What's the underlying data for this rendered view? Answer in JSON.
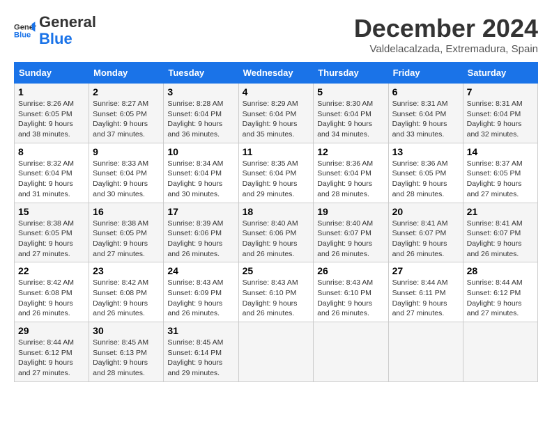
{
  "header": {
    "logo_line1": "General",
    "logo_line2": "Blue",
    "month": "December 2024",
    "location": "Valdelacalzada, Extremadura, Spain"
  },
  "weekdays": [
    "Sunday",
    "Monday",
    "Tuesday",
    "Wednesday",
    "Thursday",
    "Friday",
    "Saturday"
  ],
  "weeks": [
    [
      {
        "day": "1",
        "sunrise": "Sunrise: 8:26 AM",
        "sunset": "Sunset: 6:05 PM",
        "daylight": "Daylight: 9 hours and 38 minutes."
      },
      {
        "day": "2",
        "sunrise": "Sunrise: 8:27 AM",
        "sunset": "Sunset: 6:05 PM",
        "daylight": "Daylight: 9 hours and 37 minutes."
      },
      {
        "day": "3",
        "sunrise": "Sunrise: 8:28 AM",
        "sunset": "Sunset: 6:04 PM",
        "daylight": "Daylight: 9 hours and 36 minutes."
      },
      {
        "day": "4",
        "sunrise": "Sunrise: 8:29 AM",
        "sunset": "Sunset: 6:04 PM",
        "daylight": "Daylight: 9 hours and 35 minutes."
      },
      {
        "day": "5",
        "sunrise": "Sunrise: 8:30 AM",
        "sunset": "Sunset: 6:04 PM",
        "daylight": "Daylight: 9 hours and 34 minutes."
      },
      {
        "day": "6",
        "sunrise": "Sunrise: 8:31 AM",
        "sunset": "Sunset: 6:04 PM",
        "daylight": "Daylight: 9 hours and 33 minutes."
      },
      {
        "day": "7",
        "sunrise": "Sunrise: 8:31 AM",
        "sunset": "Sunset: 6:04 PM",
        "daylight": "Daylight: 9 hours and 32 minutes."
      }
    ],
    [
      {
        "day": "8",
        "sunrise": "Sunrise: 8:32 AM",
        "sunset": "Sunset: 6:04 PM",
        "daylight": "Daylight: 9 hours and 31 minutes."
      },
      {
        "day": "9",
        "sunrise": "Sunrise: 8:33 AM",
        "sunset": "Sunset: 6:04 PM",
        "daylight": "Daylight: 9 hours and 30 minutes."
      },
      {
        "day": "10",
        "sunrise": "Sunrise: 8:34 AM",
        "sunset": "Sunset: 6:04 PM",
        "daylight": "Daylight: 9 hours and 30 minutes."
      },
      {
        "day": "11",
        "sunrise": "Sunrise: 8:35 AM",
        "sunset": "Sunset: 6:04 PM",
        "daylight": "Daylight: 9 hours and 29 minutes."
      },
      {
        "day": "12",
        "sunrise": "Sunrise: 8:36 AM",
        "sunset": "Sunset: 6:04 PM",
        "daylight": "Daylight: 9 hours and 28 minutes."
      },
      {
        "day": "13",
        "sunrise": "Sunrise: 8:36 AM",
        "sunset": "Sunset: 6:05 PM",
        "daylight": "Daylight: 9 hours and 28 minutes."
      },
      {
        "day": "14",
        "sunrise": "Sunrise: 8:37 AM",
        "sunset": "Sunset: 6:05 PM",
        "daylight": "Daylight: 9 hours and 27 minutes."
      }
    ],
    [
      {
        "day": "15",
        "sunrise": "Sunrise: 8:38 AM",
        "sunset": "Sunset: 6:05 PM",
        "daylight": "Daylight: 9 hours and 27 minutes."
      },
      {
        "day": "16",
        "sunrise": "Sunrise: 8:38 AM",
        "sunset": "Sunset: 6:05 PM",
        "daylight": "Daylight: 9 hours and 27 minutes."
      },
      {
        "day": "17",
        "sunrise": "Sunrise: 8:39 AM",
        "sunset": "Sunset: 6:06 PM",
        "daylight": "Daylight: 9 hours and 26 minutes."
      },
      {
        "day": "18",
        "sunrise": "Sunrise: 8:40 AM",
        "sunset": "Sunset: 6:06 PM",
        "daylight": "Daylight: 9 hours and 26 minutes."
      },
      {
        "day": "19",
        "sunrise": "Sunrise: 8:40 AM",
        "sunset": "Sunset: 6:07 PM",
        "daylight": "Daylight: 9 hours and 26 minutes."
      },
      {
        "day": "20",
        "sunrise": "Sunrise: 8:41 AM",
        "sunset": "Sunset: 6:07 PM",
        "daylight": "Daylight: 9 hours and 26 minutes."
      },
      {
        "day": "21",
        "sunrise": "Sunrise: 8:41 AM",
        "sunset": "Sunset: 6:07 PM",
        "daylight": "Daylight: 9 hours and 26 minutes."
      }
    ],
    [
      {
        "day": "22",
        "sunrise": "Sunrise: 8:42 AM",
        "sunset": "Sunset: 6:08 PM",
        "daylight": "Daylight: 9 hours and 26 minutes."
      },
      {
        "day": "23",
        "sunrise": "Sunrise: 8:42 AM",
        "sunset": "Sunset: 6:08 PM",
        "daylight": "Daylight: 9 hours and 26 minutes."
      },
      {
        "day": "24",
        "sunrise": "Sunrise: 8:43 AM",
        "sunset": "Sunset: 6:09 PM",
        "daylight": "Daylight: 9 hours and 26 minutes."
      },
      {
        "day": "25",
        "sunrise": "Sunrise: 8:43 AM",
        "sunset": "Sunset: 6:10 PM",
        "daylight": "Daylight: 9 hours and 26 minutes."
      },
      {
        "day": "26",
        "sunrise": "Sunrise: 8:43 AM",
        "sunset": "Sunset: 6:10 PM",
        "daylight": "Daylight: 9 hours and 26 minutes."
      },
      {
        "day": "27",
        "sunrise": "Sunrise: 8:44 AM",
        "sunset": "Sunset: 6:11 PM",
        "daylight": "Daylight: 9 hours and 27 minutes."
      },
      {
        "day": "28",
        "sunrise": "Sunrise: 8:44 AM",
        "sunset": "Sunset: 6:12 PM",
        "daylight": "Daylight: 9 hours and 27 minutes."
      }
    ],
    [
      {
        "day": "29",
        "sunrise": "Sunrise: 8:44 AM",
        "sunset": "Sunset: 6:12 PM",
        "daylight": "Daylight: 9 hours and 27 minutes."
      },
      {
        "day": "30",
        "sunrise": "Sunrise: 8:45 AM",
        "sunset": "Sunset: 6:13 PM",
        "daylight": "Daylight: 9 hours and 28 minutes."
      },
      {
        "day": "31",
        "sunrise": "Sunrise: 8:45 AM",
        "sunset": "Sunset: 6:14 PM",
        "daylight": "Daylight: 9 hours and 29 minutes."
      },
      null,
      null,
      null,
      null
    ]
  ]
}
